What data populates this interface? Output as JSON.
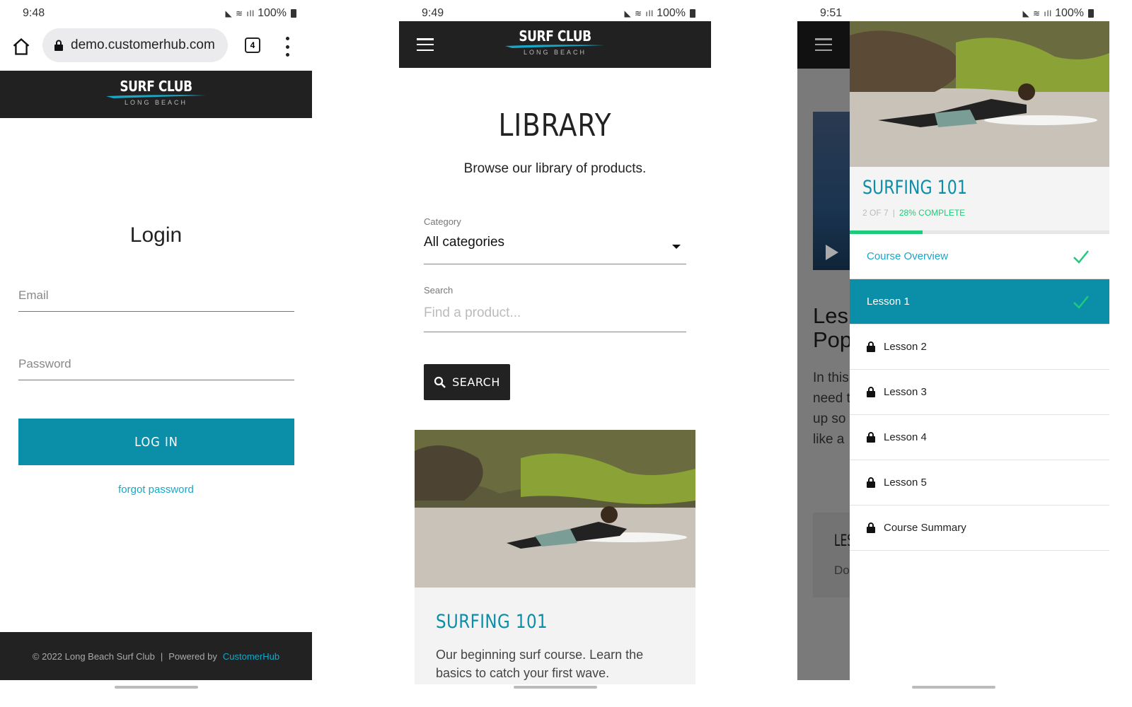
{
  "screens": [
    {
      "status": {
        "time": "9:48",
        "battery": "100%"
      },
      "browser": {
        "url": "demo.customerhub.com",
        "tab_count": "4"
      },
      "logo": {
        "title": "SURF CLUB",
        "subtitle": "LONG BEACH"
      },
      "login": {
        "title": "Login",
        "email_placeholder": "Email",
        "password_placeholder": "Password",
        "submit_label": "LOG IN",
        "forgot_label": "forgot password"
      },
      "footer": {
        "copyright": "© 2022 Long Beach Surf Club",
        "separator": "|",
        "powered_by": "Powered by",
        "brand": "CustomerHub"
      }
    },
    {
      "status": {
        "time": "9:49",
        "battery": "100%"
      },
      "logo": {
        "title": "SURF CLUB",
        "subtitle": "LONG BEACH"
      },
      "library": {
        "title": "LIBRARY",
        "subtitle": "Browse our library of products.",
        "category_label": "Category",
        "category_value": "All categories",
        "search_label": "Search",
        "search_placeholder": "Find a product...",
        "search_button": "SEARCH",
        "products": [
          {
            "name": "SURFING 101",
            "description": "Our beginning surf course. Learn the basics to catch your first wave."
          }
        ]
      }
    },
    {
      "status": {
        "time": "9:51",
        "battery": "100%"
      },
      "background_page": {
        "title_fragment": "Les\nPop",
        "text_fragment": [
          "In this",
          "need t",
          "up so",
          "like a"
        ],
        "box_title_fragment": "LES",
        "box_text_fragment": "Do"
      },
      "course": {
        "title": "SURFING 101",
        "position": "2 OF 7",
        "separator": "|",
        "complete_label": "28% COMPLETE",
        "progress_fraction": 0.28,
        "lessons": [
          {
            "label": "Course Overview",
            "state": "completed-link"
          },
          {
            "label": "Lesson 1",
            "state": "active-completed"
          },
          {
            "label": "Lesson 2",
            "state": "locked"
          },
          {
            "label": "Lesson 3",
            "state": "locked"
          },
          {
            "label": "Lesson 4",
            "state": "locked"
          },
          {
            "label": "Lesson 5",
            "state": "locked"
          },
          {
            "label": "Course Summary",
            "state": "locked"
          }
        ]
      }
    }
  ],
  "colors": {
    "accent": "#0b8ea8",
    "link": "#1aa6c5",
    "success": "#1ecb7a",
    "header": "#212121"
  }
}
